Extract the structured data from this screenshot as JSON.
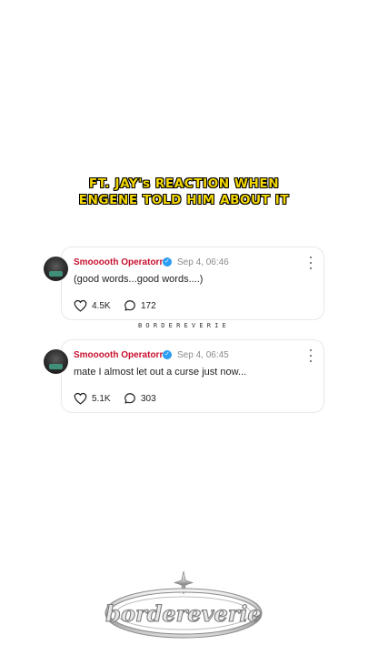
{
  "caption": {
    "line1": "FT. JAY's REACTION WHEN",
    "line2": "ENGENE TOLD HIM ABOUT IT"
  },
  "posts": [
    {
      "author": "Smooooth Operatorrrr",
      "verified": true,
      "time": "Sep 4, 06:46",
      "text": "(good words...good words....)",
      "likes": "4.5K",
      "comments": "172"
    },
    {
      "author": "Smooooth Operatorrrr",
      "verified": true,
      "time": "Sep 4, 06:45",
      "text": "mate I almost let out a curse just now...",
      "likes": "5.1K",
      "comments": "303"
    }
  ],
  "watermark": {
    "small": "BORDEREVERIE",
    "logo": "bordereverie"
  },
  "colors": {
    "caption": "#f5d800",
    "author": "#c8102e",
    "verified": "#2a9df4"
  },
  "icons": [
    "heart-icon",
    "comment-icon",
    "more-icon",
    "verified-icon",
    "sparkle-icon"
  ]
}
